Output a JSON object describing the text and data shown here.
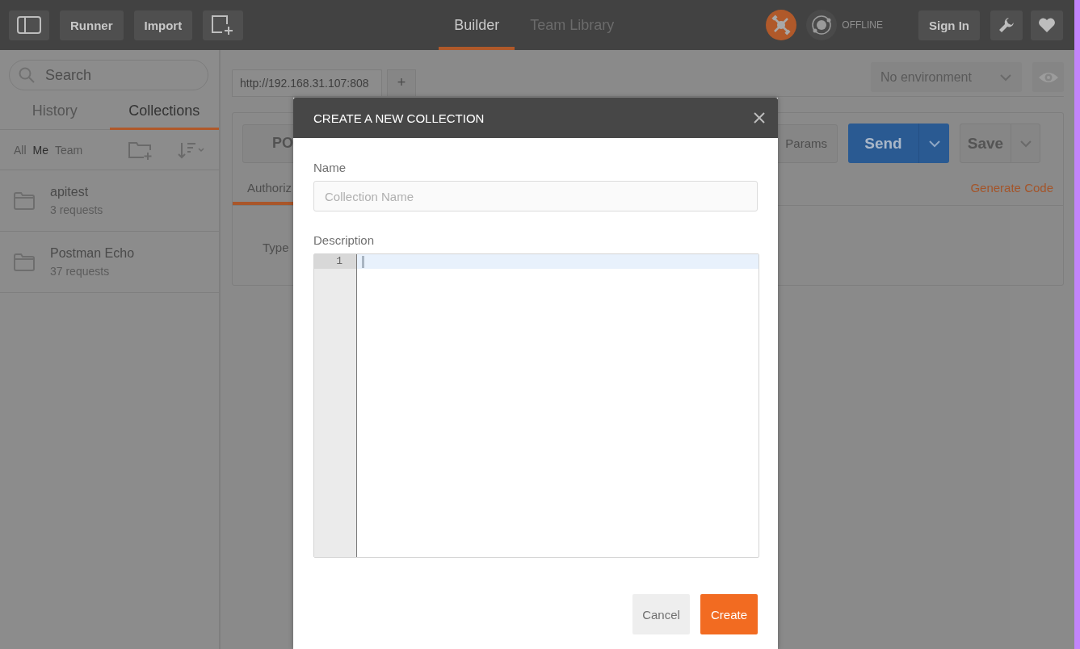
{
  "toolbar": {
    "buttons": [
      {
        "label": "Runner"
      },
      {
        "label": "Import"
      }
    ]
  },
  "header_tabs": [
    {
      "label": "Builder",
      "selected": true
    },
    {
      "label": "Team Library",
      "selected": false
    }
  ],
  "sync_status": "OFFLINE",
  "sign_in": "Sign In",
  "sidebar": {
    "search": {
      "placeholder": "Search"
    },
    "tabs": [
      {
        "label": "History",
        "selected": false
      },
      {
        "label": "Collections",
        "selected": true
      }
    ],
    "filters": [
      {
        "label": "All",
        "selected": false
      },
      {
        "label": "Me",
        "selected": true
      },
      {
        "label": "Team",
        "selected": false
      }
    ],
    "collections": [
      {
        "name": "apitest",
        "count": "3 requests"
      },
      {
        "name": "Postman Echo",
        "count": "37 requests"
      }
    ]
  },
  "request": {
    "tab_url": "http://192.168.31.107:808",
    "new_tab": "+",
    "environment": "No environment",
    "method": "PO",
    "params": "Params",
    "send": "Send",
    "save": "Save",
    "subtabs": [
      {
        "label": "Authoriz",
        "selected": true
      }
    ],
    "generate_code": "Generate Code",
    "type_label": "Type"
  },
  "modal": {
    "title": "CREATE A NEW COLLECTION",
    "name_label": "Name",
    "name_placeholder": "Collection Name",
    "description_label": "Description",
    "line_numbers": [
      "1"
    ],
    "cancel": "Cancel",
    "create": "Create"
  }
}
